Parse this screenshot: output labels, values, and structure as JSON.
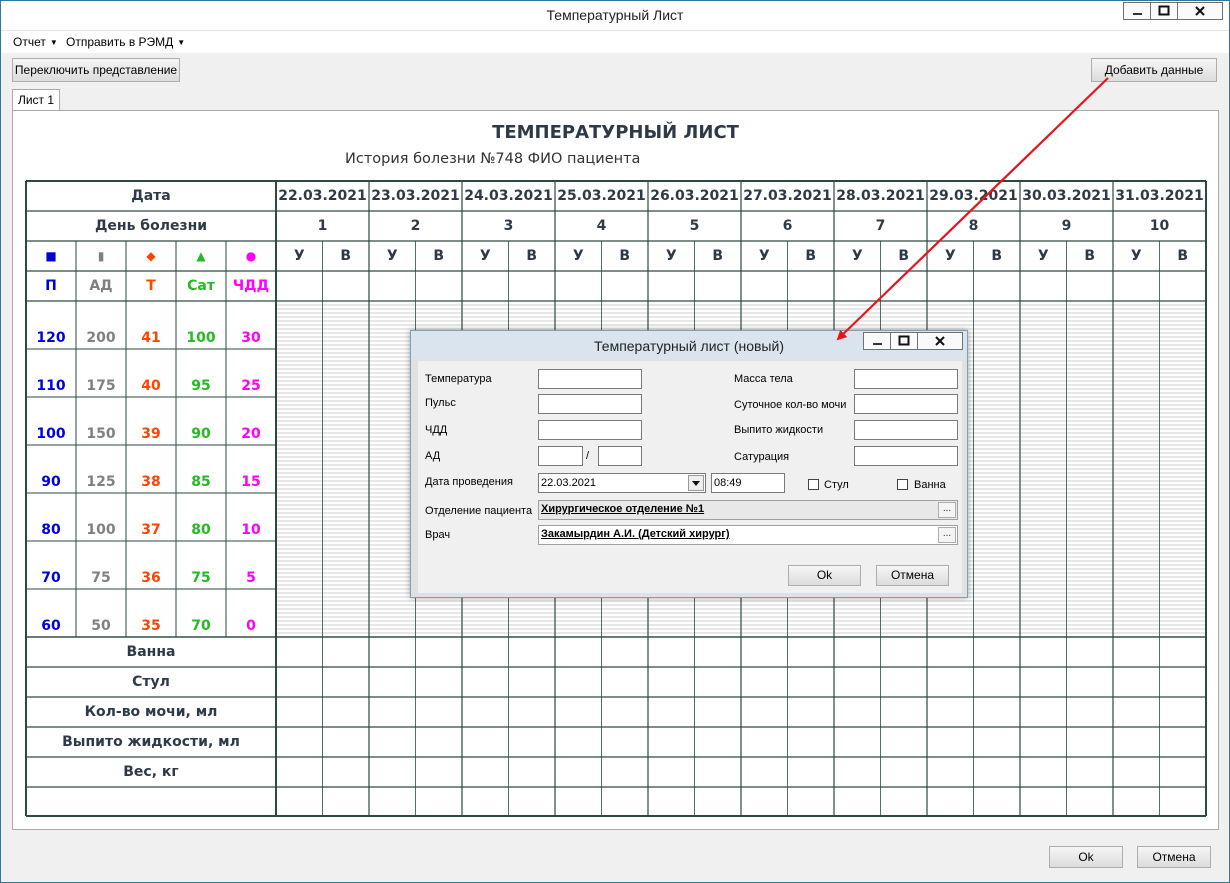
{
  "window": {
    "title": "Температурный Лист"
  },
  "menu": {
    "report": "Отчет",
    "send": "Отправить в РЭМД"
  },
  "toolbar": {
    "switch_view": "Переключить представление",
    "add_data": "Добавить данные"
  },
  "tab": {
    "label": "Лист 1"
  },
  "sheet": {
    "title": "ТЕМПЕРАТУРНЫЙ ЛИСТ",
    "subtitle": "История болезни №748 ФИО пациента",
    "date_label": "Дата",
    "day_label": "День болезни",
    "dates": [
      "22.03.2021",
      "23.03.2021",
      "24.03.2021",
      "25.03.2021",
      "26.03.2021",
      "27.03.2021",
      "28.03.2021",
      "29.03.2021",
      "30.03.2021",
      "31.03.2021"
    ],
    "days": [
      "1",
      "2",
      "3",
      "4",
      "5",
      "6",
      "7",
      "8",
      "9",
      "10"
    ],
    "morning": "У",
    "evening": "В",
    "legend": [
      {
        "symbol": "■",
        "label": "П",
        "color": "#0000dd"
      },
      {
        "symbol": "▮",
        "label": "АД",
        "color": "#808080"
      },
      {
        "symbol": "◆",
        "label": "Т",
        "color": "#ff4500"
      },
      {
        "symbol": "▲",
        "label": "Сат",
        "color": "#22bb22"
      },
      {
        "symbol": "●",
        "label": "ЧДД",
        "color": "#ff00ff"
      }
    ],
    "scales": {
      "pulse": [
        "120",
        "110",
        "100",
        "90",
        "80",
        "70",
        "60"
      ],
      "bp": [
        "200",
        "175",
        "150",
        "125",
        "100",
        "75",
        "50"
      ],
      "temp": [
        "41",
        "40",
        "39",
        "38",
        "37",
        "36",
        "35"
      ],
      "sat": [
        "100",
        "95",
        "90",
        "85",
        "80",
        "75",
        "70"
      ],
      "rr": [
        "30",
        "25",
        "20",
        "15",
        "10",
        "5",
        "0"
      ]
    },
    "bottom_rows": [
      "Ванна",
      "Стул",
      "Кол-во мочи, мл",
      "Выпито жидкости, мл",
      "Вес, кг"
    ]
  },
  "dialog": {
    "title": "Температурный лист (новый)",
    "temperature_label": "Температура",
    "pulse_label": "Пульс",
    "rr_label": "ЧДД",
    "bp_label": "АД",
    "bp_sep": "/",
    "date_label": "Дата проведения",
    "date_value": "22.03.2021",
    "time_value": "08:49",
    "stool_label": "Стул",
    "bath_label": "Ванна",
    "weight_label": "Масса тела",
    "urine_label": "Суточное кол-во мочи",
    "drunk_label": "Выпито жидкости",
    "sat_label": "Сатурация",
    "dept_label": "Отделение пациента",
    "dept_value": "Хирургическое отделение №1",
    "doctor_label": "Врач",
    "doctor_value": "Закамырдин А.И. (Детский хирург)",
    "ok": "Ok",
    "cancel": "Отмена"
  },
  "footer": {
    "ok": "Ok",
    "cancel": "Отмена"
  },
  "colors": {
    "arrow": "#e8141c",
    "grid_line": "#2e4a3e"
  }
}
